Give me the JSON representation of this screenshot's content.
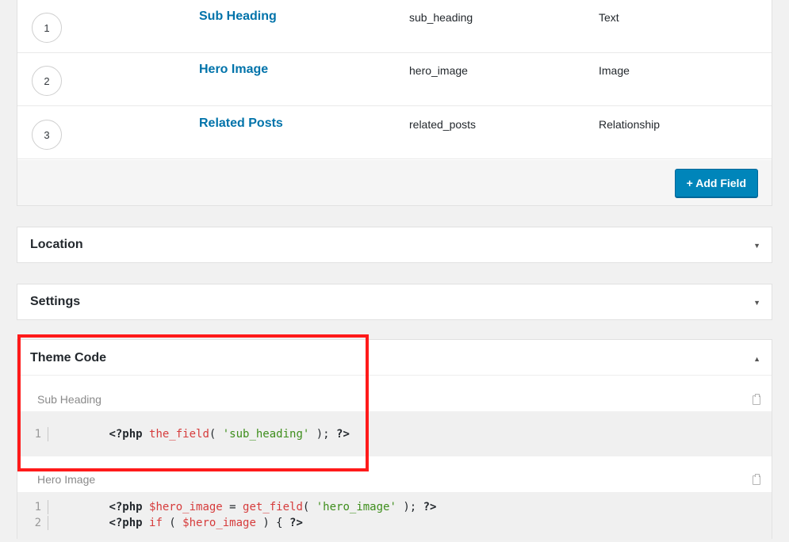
{
  "fields": [
    {
      "order": "1",
      "label": "Sub Heading",
      "name": "sub_heading",
      "type": "Text"
    },
    {
      "order": "2",
      "label": "Hero Image",
      "name": "hero_image",
      "type": "Image"
    },
    {
      "order": "3",
      "label": "Related Posts",
      "name": "related_posts",
      "type": "Relationship"
    }
  ],
  "add_field_label": "+ Add Field",
  "location": {
    "title": "Location",
    "toggle": "▼"
  },
  "settings": {
    "title": "Settings",
    "toggle": "▼"
  },
  "theme_code": {
    "title": "Theme Code",
    "toggle": "▲",
    "blocks": [
      {
        "label": "Sub Heading",
        "lines": [
          {
            "num": "1",
            "tokens": [
              {
                "t": "php",
                "v": "<?php "
              },
              {
                "t": "fn",
                "v": "the_field"
              },
              {
                "t": "punc",
                "v": "( "
              },
              {
                "t": "str",
                "v": "'sub_heading'"
              },
              {
                "t": "punc",
                "v": " ); "
              },
              {
                "t": "php",
                "v": "?>"
              }
            ]
          }
        ]
      },
      {
        "label": "Hero Image",
        "lines": [
          {
            "num": "1",
            "tokens": [
              {
                "t": "php",
                "v": "<?php "
              },
              {
                "t": "var",
                "v": "$hero_image"
              },
              {
                "t": "punc",
                "v": " = "
              },
              {
                "t": "fn",
                "v": "get_field"
              },
              {
                "t": "punc",
                "v": "( "
              },
              {
                "t": "str",
                "v": "'hero_image'"
              },
              {
                "t": "punc",
                "v": " ); "
              },
              {
                "t": "php",
                "v": "?>"
              }
            ]
          },
          {
            "num": "2",
            "tokens": [
              {
                "t": "php",
                "v": "<?php "
              },
              {
                "t": "kw",
                "v": "if"
              },
              {
                "t": "punc",
                "v": " ( "
              },
              {
                "t": "var",
                "v": "$hero_image"
              },
              {
                "t": "punc",
                "v": " ) { "
              },
              {
                "t": "php",
                "v": "?>"
              }
            ]
          }
        ]
      }
    ]
  },
  "colors": {
    "link": "#0073aa",
    "button": "#0085ba",
    "highlight": "#ff1a1a"
  },
  "icons": {
    "toggle_closed": "arrow-down-icon",
    "toggle_open": "arrow-up-icon",
    "copy": "clipboard-icon"
  }
}
